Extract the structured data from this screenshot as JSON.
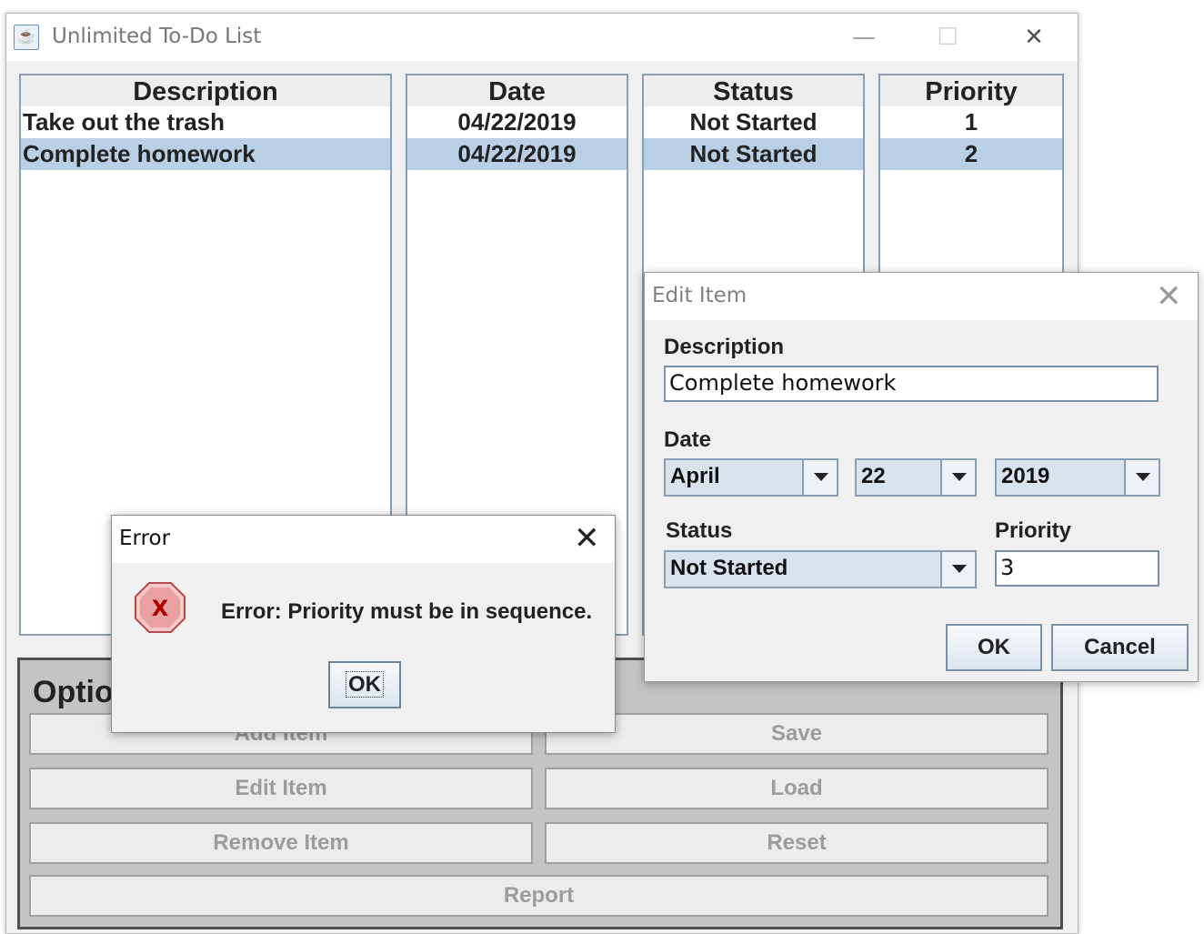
{
  "window": {
    "title": "Unlimited To-Do List",
    "minimize": "—",
    "maximize": "☐",
    "close": "✕"
  },
  "table": {
    "columns": [
      "Description",
      "Date",
      "Status",
      "Priority"
    ],
    "rows": [
      {
        "description": "Take out the trash",
        "date": "04/22/2019",
        "status": "Not Started",
        "priority": "1"
      },
      {
        "description": "Complete homework",
        "date": "04/22/2019",
        "status": "Not Started",
        "priority": "2",
        "selected": true
      }
    ]
  },
  "options": {
    "title": "Options",
    "buttons": {
      "add": "Add Item",
      "save": "Save",
      "edit": "Edit Item",
      "load": "Load",
      "remove": "Remove Item",
      "reset": "Reset",
      "report": "Report"
    }
  },
  "edit_dialog": {
    "title": "Edit Item",
    "close": "✕",
    "description_label": "Description",
    "description_value": "Complete homework",
    "date_label": "Date",
    "month": "April",
    "day": "22",
    "year": "2019",
    "status_label": "Status",
    "status_value": "Not Started",
    "priority_label": "Priority",
    "priority_value": "3",
    "ok": "OK",
    "cancel": "Cancel"
  },
  "error_dialog": {
    "title": "Error",
    "close": "✕",
    "message": "Error: Priority must be in sequence.",
    "ok": "OK",
    "icon_glyph": "X"
  },
  "colors": {
    "selection": "#b8cfe5",
    "error_icon": "#e05a5a"
  }
}
